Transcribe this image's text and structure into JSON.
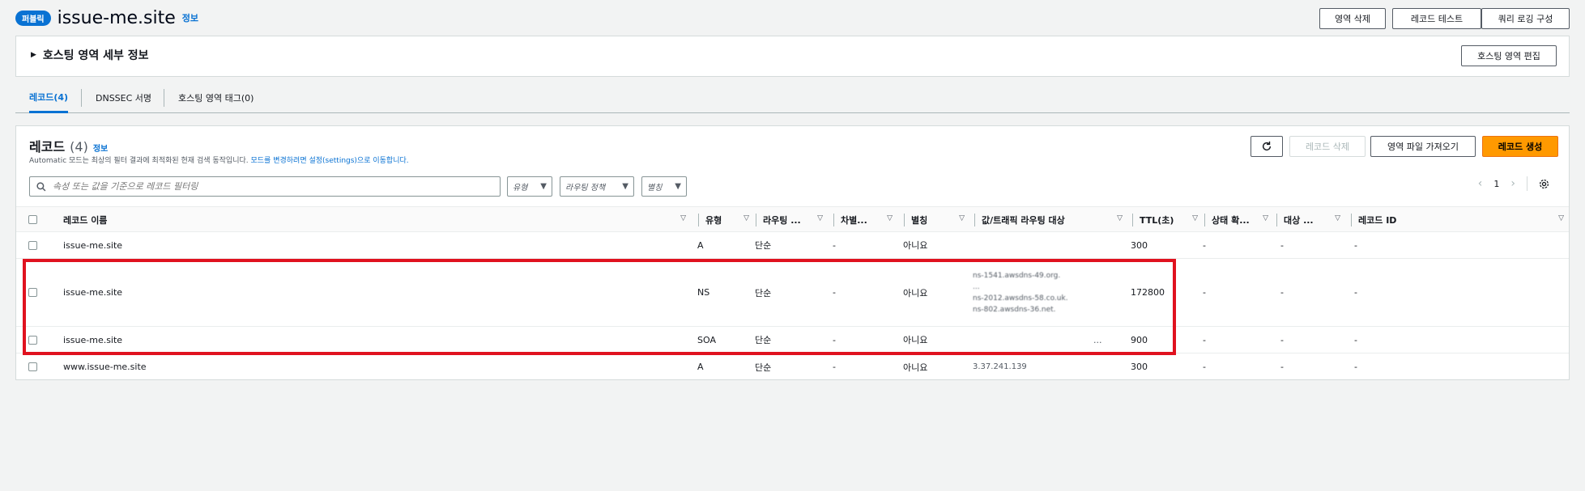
{
  "header": {
    "badge": "퍼블릭",
    "title": "issue-me.site",
    "info": "정보"
  },
  "top_actions": {
    "delete_zone": "영역 삭제",
    "test_record": "레코드 테스트",
    "query_logging": "쿼리 로깅 구성"
  },
  "details": {
    "label": "호스팅 영역 세부 정보",
    "edit_button": "호스팅 영역 편집"
  },
  "tabs": [
    {
      "label": "레코드(4)"
    },
    {
      "label": "DNSSEC 서명"
    },
    {
      "label": "호스팅 영역 태그(0)"
    }
  ],
  "records": {
    "title": "레코드",
    "count": "(4)",
    "info": "정보",
    "desc_prefix": "Automatic 모드는 최상의 필터 결과에 최적화된 현재 검색 동작입니다.",
    "desc_link": "모드를 변경하려면 설정(settings)으로 이동합니다.",
    "actions": {
      "delete": "레코드 삭제",
      "import": "영역 파일 가져오기",
      "create": "레코드 생성"
    },
    "search_placeholder": "속성 또는 값을 기준으로 레코드 필터링",
    "filters": {
      "type": "유형",
      "routing": "라우팅 정책",
      "alias": "별칭"
    },
    "page": "1"
  },
  "columns": [
    "레코드 이름",
    "유형",
    "라우팅 ...",
    "차별...",
    "별칭",
    "값/트래픽 라우팅 대상",
    "TTL(초)",
    "상태 확...",
    "대상 ...",
    "레코드 ID"
  ],
  "rows": [
    {
      "name": "issue-me.site",
      "type": "A",
      "routing": "단순",
      "diff": "-",
      "alias": "아니요",
      "value": "",
      "ttl": "300",
      "health": "-",
      "target": "-",
      "id": "-"
    },
    {
      "name": "issue-me.site",
      "type": "NS",
      "routing": "단순",
      "diff": "-",
      "alias": "아니요",
      "value_lines": [
        "ns-1541.awsdns-49.org.",
        "...",
        "ns-2012.awsdns-58.co.uk.",
        "ns-802.awsdns-36.net."
      ],
      "ttl": "172800",
      "health": "-",
      "target": "-",
      "id": "-"
    },
    {
      "name": "issue-me.site",
      "type": "SOA",
      "routing": "단순",
      "diff": "-",
      "alias": "아니요",
      "value": "...",
      "ttl": "900",
      "health": "-",
      "target": "-",
      "id": "-"
    },
    {
      "name": "www.issue-me.site",
      "type": "A",
      "routing": "단순",
      "diff": "-",
      "alias": "아니요",
      "value": "3.37.241.139",
      "ttl": "300",
      "health": "-",
      "target": "-",
      "id": "-"
    }
  ],
  "colors": {
    "accent": "#0972d3",
    "primary_button": "#ff9900",
    "highlight": "#e0121f"
  },
  "icons": {
    "refresh": "refresh-icon",
    "search": "search-icon",
    "settings": "gear-icon",
    "prev": "chevron-left-icon",
    "next": "chevron-right-icon"
  }
}
